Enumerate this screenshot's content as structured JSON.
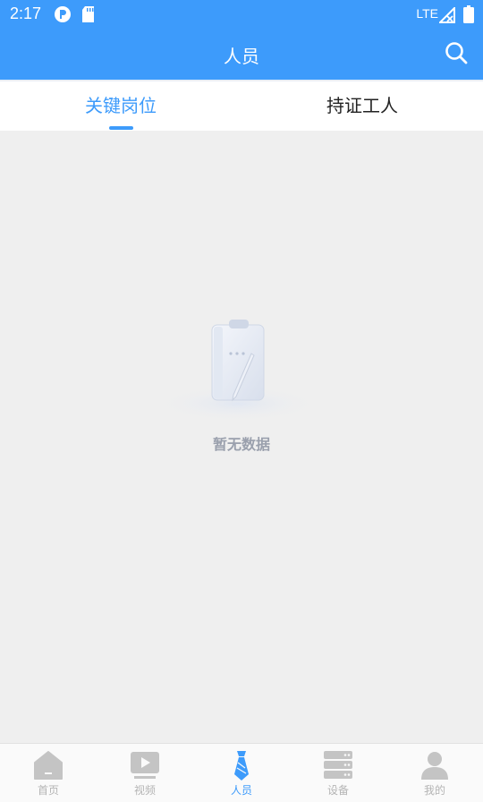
{
  "status_bar": {
    "time": "2:17",
    "network": "LTE"
  },
  "app_bar": {
    "title": "人员"
  },
  "tabs": [
    {
      "label": "关键岗位",
      "active": true
    },
    {
      "label": "持证工人",
      "active": false
    }
  ],
  "empty_state": {
    "message": "暂无数据"
  },
  "bottom_nav": [
    {
      "label": "首页",
      "icon": "home-icon",
      "active": false
    },
    {
      "label": "视频",
      "icon": "video-icon",
      "active": false
    },
    {
      "label": "人员",
      "icon": "tie-icon",
      "active": true
    },
    {
      "label": "设备",
      "icon": "server-icon",
      "active": false
    },
    {
      "label": "我的",
      "icon": "user-icon",
      "active": false
    }
  ],
  "colors": {
    "primary": "#3d9bfb",
    "nav_inactive": "#b4b4b4",
    "empty_text": "#9aa0ad",
    "background": "#efefef"
  }
}
